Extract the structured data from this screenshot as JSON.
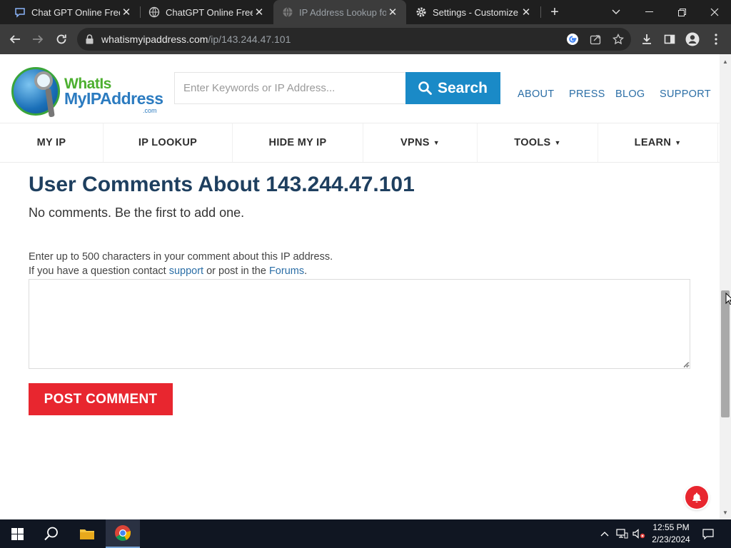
{
  "browser": {
    "tabs": [
      {
        "title": "Chat GPT Online Free - ",
        "icon": "chat-bubble-icon",
        "active": false
      },
      {
        "title": "ChatGPT Online Free | f",
        "icon": "globe-icon",
        "active": false
      },
      {
        "title": "IP Address Lookup for ",
        "icon": "globe-icon",
        "active": true
      },
      {
        "title": "Settings - Customize p",
        "icon": "gear-icon",
        "active": false
      }
    ],
    "new_tab_label": "+",
    "url_domain": "whatismyipaddress.com",
    "url_path": "/ip/143.244.47.101"
  },
  "site": {
    "logo": {
      "word1": "WhatIs",
      "word2": "MyIPAddress",
      "word3": ".com"
    },
    "search": {
      "placeholder": "Enter Keywords or IP Address...",
      "button_label": "Search"
    },
    "top_links": [
      "ABOUT",
      "PRESS",
      "BLOG",
      "SUPPORT"
    ],
    "nav": [
      {
        "label": "MY IP",
        "dropdown": false
      },
      {
        "label": "IP LOOKUP",
        "dropdown": false
      },
      {
        "label": "HIDE MY IP",
        "dropdown": false
      },
      {
        "label": "VPNS",
        "dropdown": true
      },
      {
        "label": "TOOLS",
        "dropdown": true
      },
      {
        "label": "LEARN",
        "dropdown": true
      }
    ],
    "caret": "▼"
  },
  "content": {
    "heading": "User Comments About 143.244.47.101",
    "no_comments": "No comments. Be the first to add one.",
    "instructions_line1": "Enter up to 500 characters in your comment about this IP address.",
    "instructions_line2_prefix": "If you have a question contact ",
    "support_link": "support",
    "instructions_line2_middle": " or post in the ",
    "forums_link": "Forums",
    "instructions_line2_suffix": ".",
    "comment_value": "",
    "post_button": "POST COMMENT"
  },
  "taskbar": {
    "time": "12:55 PM",
    "date": "2/23/2024"
  },
  "colors": {
    "accent_blue": "#1a8ac7",
    "post_red": "#e8262f",
    "heading_navy": "#1e3f5f",
    "link_blue": "#2b6ea6"
  }
}
